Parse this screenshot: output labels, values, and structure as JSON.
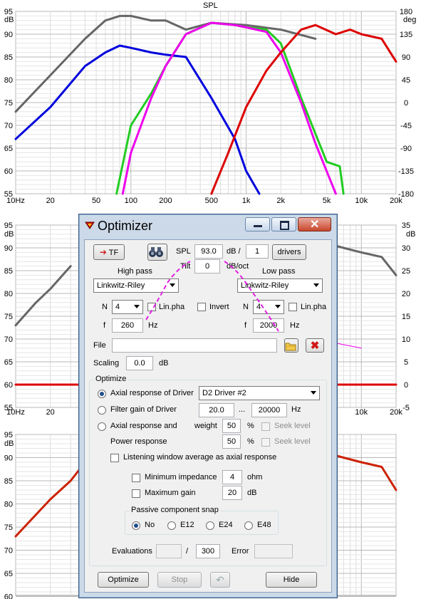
{
  "charts": {
    "spl_top": {
      "title": "SPL",
      "unit_left": "dB",
      "unit_right": "deg",
      "y_ticks_left": [
        "95",
        "90",
        "85",
        "80",
        "75",
        "70",
        "65",
        "60",
        "55"
      ],
      "y_ticks_right": [
        "180",
        "135",
        "90",
        "45",
        "0",
        "-45",
        "-90",
        "-135",
        "-180"
      ],
      "x_ticks": [
        "10Hz",
        "20",
        "50",
        "100",
        "200",
        "500",
        "1k",
        "2k",
        "5k",
        "10k",
        "20k"
      ]
    },
    "middle": {
      "unit_left": "dB",
      "unit_right": "dB",
      "y_ticks_left": [
        "95",
        "90",
        "85",
        "80",
        "75",
        "70",
        "65",
        "60",
        "55"
      ],
      "y_ticks_right": [
        "35",
        "30",
        "25",
        "20",
        "15",
        "10",
        "5",
        "0",
        "-5"
      ],
      "x_ticks": [
        "10Hz",
        "20",
        "10k",
        "20k"
      ]
    },
    "bottom": {
      "unit_left": "dB",
      "y_ticks_left": [
        "95",
        "90",
        "85",
        "80",
        "75",
        "70",
        "65",
        "60"
      ]
    }
  },
  "chart_data": [
    {
      "type": "line",
      "title": "SPL",
      "xlabel": "",
      "ylabel": "dB",
      "x_scale": "log",
      "xlim": [
        10,
        20000
      ],
      "ylim": [
        55,
        95
      ],
      "y2lim": [
        -180,
        180
      ],
      "ylabel2": "deg",
      "grid": true,
      "series": [
        {
          "color": "#666666",
          "x": [
            10,
            20,
            40,
            60,
            80,
            100,
            150,
            200,
            300,
            500,
            1000,
            2000,
            4000
          ],
          "y": [
            73,
            81,
            89,
            93,
            94,
            94,
            93,
            93,
            91,
            92.5,
            92,
            91,
            89
          ]
        },
        {
          "color": "#0000dd",
          "x": [
            10,
            20,
            40,
            60,
            80,
            100,
            150,
            200,
            300,
            500,
            800,
            1000,
            1300
          ],
          "y": [
            67,
            74,
            83,
            86,
            87.5,
            87,
            86,
            85.5,
            85,
            76,
            67,
            60,
            55
          ]
        },
        {
          "color": "#22cc22",
          "x": [
            75,
            100,
            150,
            200,
            300,
            500,
            800,
            1000,
            1500,
            2000,
            3000,
            5000,
            6500,
            7000
          ],
          "y": [
            55,
            70,
            77,
            83,
            90,
            92.5,
            92,
            91.5,
            91,
            88,
            76,
            62,
            61,
            55
          ]
        },
        {
          "color": "#ee00ee",
          "x": [
            85,
            100,
            150,
            200,
            300,
            500,
            800,
            1000,
            1500,
            2000,
            3000,
            4000,
            6000
          ],
          "y": [
            55,
            64,
            76,
            83,
            90,
            92.5,
            92,
            91.5,
            90.5,
            86,
            75,
            66,
            55
          ]
        },
        {
          "color": "#dd0000",
          "x": [
            500,
            700,
            1000,
            1500,
            2000,
            3000,
            4000,
            6000,
            8000,
            10000,
            15000,
            20000
          ],
          "y": [
            55,
            64,
            74,
            82,
            86,
            91,
            92,
            90,
            91,
            90,
            89,
            84
          ]
        }
      ]
    },
    {
      "type": "line",
      "xlabel": "",
      "ylabel": "dB",
      "x_scale": "log",
      "xlim": [
        10,
        20000
      ],
      "ylim": [
        55,
        95
      ],
      "y2lim": [
        -5,
        35
      ],
      "ylabel2": "dB",
      "grid": true,
      "series": [
        {
          "color": "#666666",
          "x": [
            10,
            15,
            20,
            30
          ],
          "y": [
            73,
            78,
            81,
            86
          ]
        },
        {
          "color": "#666666",
          "x": [
            5000,
            7000,
            10000,
            15000,
            20000
          ],
          "y": [
            91,
            90,
            89,
            88,
            84
          ]
        },
        {
          "color": "#dd0000",
          "x": [
            10,
            20000
          ],
          "y": [
            60,
            60
          ]
        },
        {
          "color": "#ee00ee",
          "x": [
            5000,
            10000
          ],
          "y": [
            69.5,
            68
          ]
        }
      ]
    },
    {
      "type": "line",
      "xlabel": "",
      "ylabel": "dB",
      "x_scale": "log",
      "xlim": [
        10,
        20000
      ],
      "ylim": [
        60,
        95
      ],
      "grid": true,
      "series": [
        {
          "color": "#cc2200",
          "x": [
            10,
            20,
            30,
            40
          ],
          "y": [
            73,
            81,
            85,
            89
          ]
        },
        {
          "color": "#cc2200",
          "x": [
            5000,
            7000,
            10000,
            15000,
            20000
          ],
          "y": [
            91,
            90,
            89,
            88,
            83
          ]
        }
      ]
    }
  ],
  "dialog": {
    "title": "Optimizer",
    "tf_label": "TF",
    "spl_label": "SPL",
    "spl_value": "93.0",
    "db_slash": "dB /",
    "drivers_count": "1",
    "drivers_label": "drivers",
    "tilt_label": "Tilt",
    "tilt_value": "0",
    "tilt_unit": "dB/oct",
    "highpass": {
      "label": "High pass",
      "type": "Linkwitz-Riley",
      "n_label": "N",
      "n_value": "4",
      "linpha": "Lin.pha",
      "invert": "Invert",
      "f_label": "f",
      "f_value": "260",
      "f_unit": "Hz"
    },
    "lowpass": {
      "label": "Low pass",
      "type": "Linkwitz-Riley",
      "n_label": "N",
      "n_value": "4",
      "linpha": "Lin.pha",
      "f_label": "f",
      "f_value": "2000",
      "f_unit": "Hz"
    },
    "file_label": "File",
    "file_value": "",
    "scaling_label": "Scaling",
    "scaling_value": "0.0",
    "scaling_unit": "dB",
    "optimize": {
      "group_label": "Optimize",
      "opt1": "Axial response of Driver",
      "driver_select": "D2 Driver #2",
      "opt2": "Filter gain of Driver",
      "gain_from": "20.0",
      "gain_dots": "...",
      "gain_to": "20000",
      "gain_unit": "Hz",
      "opt3": "Axial response and",
      "weight_label": "weight",
      "weight1": "50",
      "weight2": "50",
      "percent": "%",
      "seek_level": "Seek level",
      "power_response": "Power response",
      "listening_window": "Listening window average as axial response",
      "min_imp_label": "Minimum impedance",
      "min_imp_value": "4",
      "min_imp_unit": "ohm",
      "max_gain_label": "Maximum gain",
      "max_gain_value": "20",
      "max_gain_unit": "dB",
      "snap_label": "Passive component snap",
      "snap_options": [
        "No",
        "E12",
        "E24",
        "E48"
      ],
      "evaluations_label": "Evaluations",
      "evaluations_value": "",
      "evaluations_slash": "/",
      "evaluations_max": "300",
      "error_label": "Error",
      "error_value": ""
    },
    "buttons": {
      "optimize": "Optimize",
      "stop": "Stop",
      "hide": "Hide"
    }
  }
}
